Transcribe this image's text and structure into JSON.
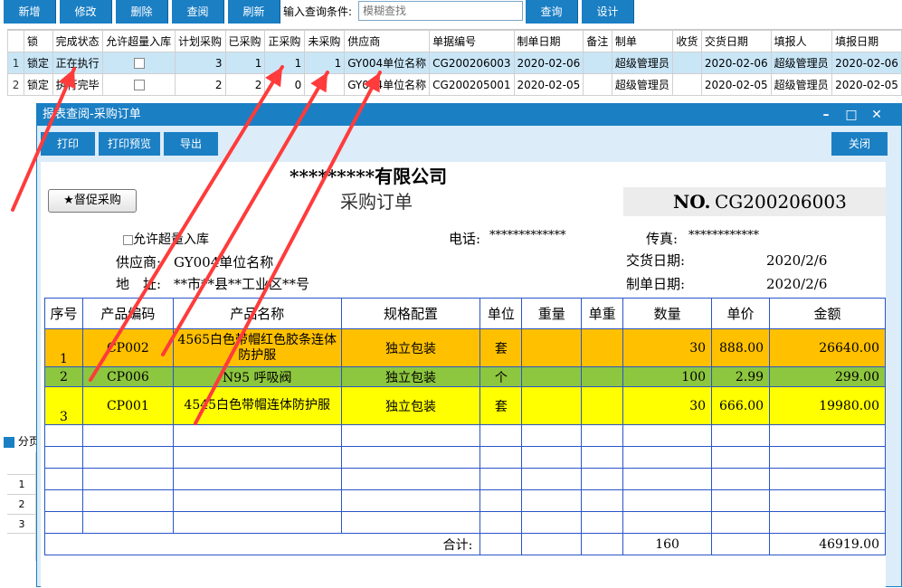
{
  "toolbar": {
    "buttons": [
      "新增",
      "修改",
      "删除",
      "查阅",
      "刷新"
    ],
    "search_label": "输入查询条件:",
    "search_placeholder": "模糊查找",
    "query_label": "查询",
    "design_label": "设计"
  },
  "grid": {
    "columns": [
      "锁",
      "完成状态",
      "允许超量入库",
      "计划采购",
      "已采购",
      "正采购",
      "未采购",
      "供应商",
      "单据编号",
      "制单日期",
      "备注",
      "制单",
      "收货",
      "交货日期",
      "填报人",
      "填报日期"
    ],
    "rows": [
      {
        "rownum": "1",
        "lock": "锁定",
        "status": "正在执行",
        "plan": "3",
        "done": "1",
        "doing": "1",
        "todo": "1",
        "supplier": "GY004单位名称",
        "code": "CG200206003",
        "date": "2020-02-06",
        "note": "",
        "maker": "超级管理员",
        "recv": "",
        "deliver": "2020-02-06",
        "filler": "超级管理员",
        "filldate": "2020-02-06"
      },
      {
        "rownum": "2",
        "lock": "锁定",
        "status": "执行完毕",
        "plan": "2",
        "done": "2",
        "doing": "0",
        "todo": "",
        "supplier": "GY004单位名称",
        "code": "CG200205001",
        "date": "2020-02-05",
        "note": "",
        "maker": "超级管理员",
        "recv": "",
        "deliver": "2020-02-05",
        "filler": "超级管理员",
        "filldate": "2020-02-05"
      }
    ]
  },
  "bottom": {
    "tab_label": "分页",
    "row_numbers": [
      "1",
      "2",
      "3"
    ]
  },
  "modal": {
    "title": "报表查阅-采购订单",
    "print_label": "打印",
    "preview_label": "打印预览",
    "export_label": "导出",
    "close_label": "关闭"
  },
  "report": {
    "company": "*********有限公司",
    "doc_title": "采购订单",
    "urge_label": "★督促采购",
    "no_label": "NO.",
    "no_value": "CG200206003",
    "allow_over_label": "允许超量入库",
    "phone_label": "电话:",
    "phone_value": "*************",
    "fax_label": "传真:",
    "fax_value": "************",
    "supplier_label": "供应商:",
    "supplier_value": "GY004单位名称",
    "address_label": "地　址:",
    "address_value": "**市**县**工业区**号",
    "deliver_label": "交货日期:",
    "deliver_value": "2020/2/6",
    "make_label": "制单日期:",
    "make_value": "2020/2/6",
    "columns": [
      "序号",
      "产品编码",
      "产品名称",
      "规格配置",
      "单位",
      "重量",
      "单重",
      "数量",
      "单价",
      "金额"
    ],
    "items": [
      {
        "seq": "1",
        "code": "CP002",
        "name": "4565白色带帽红色胶条连体防护服",
        "spec": "独立包装",
        "unit": "套",
        "weight": "",
        "unit_weight": "",
        "qty": "30",
        "price": "888.00",
        "amount": "26640.00",
        "color": "#ffc000"
      },
      {
        "seq": "2",
        "code": "CP006",
        "name": "N95 呼吸阀",
        "spec": "独立包装",
        "unit": "个",
        "weight": "",
        "unit_weight": "",
        "qty": "100",
        "price": "2.99",
        "amount": "299.00",
        "color": "#8dc63f"
      },
      {
        "seq": "3",
        "code": "CP001",
        "name": "4545白色带帽连体防护服",
        "spec": "独立包装",
        "unit": "套",
        "weight": "",
        "unit_weight": "",
        "qty": "30",
        "price": "666.00",
        "amount": "19980.00",
        "color": "#ffff00"
      }
    ],
    "total_label": "合计:",
    "total_qty": "160",
    "total_amount": "46919.00"
  },
  "annotation_color": "#ff3b3b"
}
